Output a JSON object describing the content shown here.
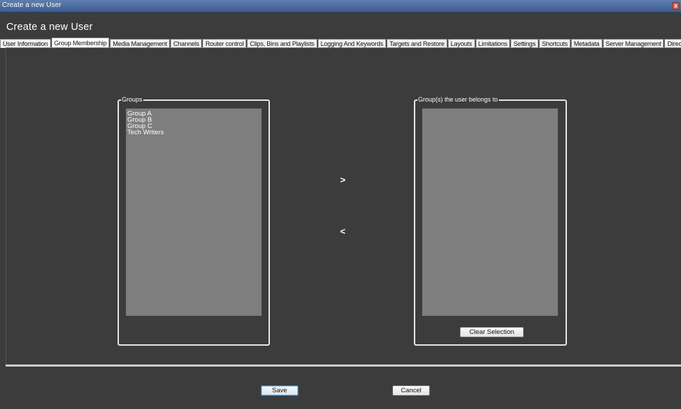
{
  "window": {
    "title": "Create a new User",
    "close_glyph": "x"
  },
  "header": {
    "title": "Create a new User"
  },
  "tabs": [
    {
      "label": "User Information",
      "active": false
    },
    {
      "label": "Group Membership",
      "active": true
    },
    {
      "label": "Media Management",
      "active": false
    },
    {
      "label": "Channels",
      "active": false
    },
    {
      "label": "Router control",
      "active": false
    },
    {
      "label": "Clips, Bins and Playlists",
      "active": false
    },
    {
      "label": "Logging And Keywords",
      "active": false
    },
    {
      "label": "Targets and Restore",
      "active": false
    },
    {
      "label": "Layouts",
      "active": false
    },
    {
      "label": "Limitations",
      "active": false
    },
    {
      "label": "Settings",
      "active": false
    },
    {
      "label": "Shortcuts",
      "active": false
    },
    {
      "label": "Metadata",
      "active": false
    },
    {
      "label": "Server Management",
      "active": false
    },
    {
      "label": "Directors Cut",
      "active": false
    }
  ],
  "groups_panel": {
    "legend": "Groups",
    "items": [
      "Group A",
      "Group B",
      "Group C",
      "Tech Writers"
    ]
  },
  "member_panel": {
    "legend": "Group(s) the user belongs to",
    "items": [],
    "clear_label": "Clear Selection"
  },
  "transfer": {
    "add_label": ">",
    "remove_label": "<"
  },
  "footer": {
    "save_label": "Save",
    "cancel_label": "Cancel"
  }
}
